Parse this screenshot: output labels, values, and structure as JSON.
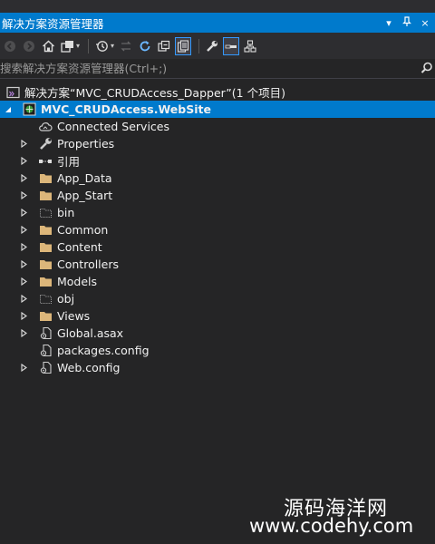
{
  "window": {
    "title": "解决方案资源管理器",
    "pin_icon": "pin-icon",
    "close_glyph": "×"
  },
  "search": {
    "placeholder": "搜索解决方案资源管理器(Ctrl+;)"
  },
  "solution": {
    "label": "解决方案“MVC_CRUDAccess_Dapper”(1 个项目)"
  },
  "project": {
    "label": "MVC_CRUDAccess.WebSite"
  },
  "items": [
    {
      "label": "Connected Services",
      "icon": "connected-services-icon",
      "expandable": false
    },
    {
      "label": "Properties",
      "icon": "wrench-icon",
      "expandable": true
    },
    {
      "label": "引用",
      "icon": "references-icon",
      "expandable": true
    },
    {
      "label": "App_Data",
      "icon": "folder-icon",
      "expandable": true
    },
    {
      "label": "App_Start",
      "icon": "folder-icon",
      "expandable": true
    },
    {
      "label": "bin",
      "icon": "dotted-folder-icon",
      "expandable": true
    },
    {
      "label": "Common",
      "icon": "folder-icon",
      "expandable": true
    },
    {
      "label": "Content",
      "icon": "folder-icon",
      "expandable": true
    },
    {
      "label": "Controllers",
      "icon": "folder-icon",
      "expandable": true
    },
    {
      "label": "Models",
      "icon": "folder-icon",
      "expandable": true
    },
    {
      "label": "obj",
      "icon": "dotted-folder-icon",
      "expandable": true
    },
    {
      "label": "Views",
      "icon": "folder-icon",
      "expandable": true
    },
    {
      "label": "Global.asax",
      "icon": "config-file-icon",
      "expandable": true
    },
    {
      "label": "packages.config",
      "icon": "config-file-icon",
      "expandable": false
    },
    {
      "label": "Web.config",
      "icon": "config-file-icon",
      "expandable": true
    }
  ],
  "watermark": {
    "line1": "源码海洋网",
    "line2": "www.codehy.com"
  },
  "colors": {
    "accent": "#007acc",
    "background": "#252526",
    "folder": "#dcb67a"
  }
}
